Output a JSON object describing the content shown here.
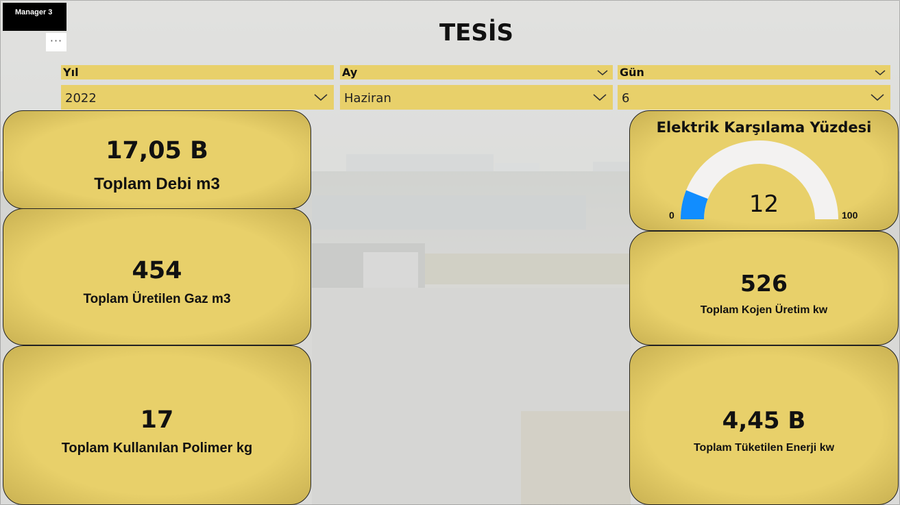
{
  "header": {
    "badge": "Manager 3",
    "more_glyph": "···",
    "title": "TESİS"
  },
  "filters": [
    {
      "label": "Yıl",
      "value": "2022"
    },
    {
      "label": "Ay",
      "value": "Haziran"
    },
    {
      "label": "Gün",
      "value": "6"
    }
  ],
  "kpis": {
    "debi": {
      "value": "17,05 B",
      "label": "Toplam Debi m3"
    },
    "gaz": {
      "value": "454",
      "label": "Toplam Üretilen Gaz m3"
    },
    "polimer": {
      "value": "17",
      "label": "Toplam Kullanılan Polimer kg"
    },
    "kojen": {
      "value": "526",
      "label": "Toplam Kojen Üretim kw"
    },
    "enerji": {
      "value": "4,45 B",
      "label": "Toplam Tüketilen Enerji kw"
    }
  },
  "gauge": {
    "title": "Elektrik Karşılama Yüzdesi",
    "value": "12",
    "min": "0",
    "max": "100",
    "fraction": 0.12,
    "fill_color": "#118dff",
    "track_color": "#f3f2f1"
  },
  "colors": {
    "card": "#e8d06a",
    "slicer": "#e8d06a"
  }
}
